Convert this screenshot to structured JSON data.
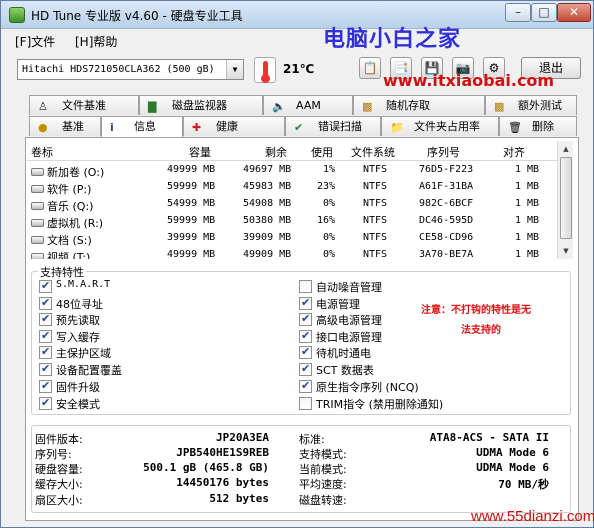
{
  "window": {
    "title": "HD Tune 专业版 v4.60 - 硬盘专业工具"
  },
  "watermarks": {
    "top": "电脑小白之家",
    "url": "www.itxiaobai.com",
    "bottom": "www.55dianzi.com"
  },
  "menu": [
    "[F]文件",
    "[H]帮助"
  ],
  "toolbar": {
    "drive": "Hitachi HDS721050CLA362 (500 gB)",
    "temperature": "21℃",
    "exit_label": "退出"
  },
  "tabs_top": [
    "文件基准",
    "磁盘监视器",
    "AAM",
    "随机存取",
    "额外测试"
  ],
  "tabs_bottom": [
    "基准",
    "信息",
    "健康",
    "错误扫描",
    "文件夹占用率",
    "删除"
  ],
  "partitions": {
    "headers": [
      "卷标",
      "容量",
      "剩余",
      "使用",
      "文件系统",
      "序列号",
      "对齐"
    ],
    "rows": [
      [
        "新加卷 (O:)",
        "49999 MB",
        "49697 MB",
        "1%",
        "NTFS",
        "76D5-F223",
        "1 MB"
      ],
      [
        "软件 (P:)",
        "59999 MB",
        "45983 MB",
        "23%",
        "NTFS",
        "A61F-31BA",
        "1 MB"
      ],
      [
        "音乐 (Q:)",
        "54999 MB",
        "54908 MB",
        "0%",
        "NTFS",
        "982C-6BCF",
        "1 MB"
      ],
      [
        "虚拟机 (R:)",
        "59999 MB",
        "50380 MB",
        "16%",
        "NTFS",
        "DC46-595D",
        "1 MB"
      ],
      [
        "文档 (S:)",
        "39999 MB",
        "39909 MB",
        "0%",
        "NTFS",
        "CE58-CD96",
        "1 MB"
      ],
      [
        "视频 (T:)",
        "49999 MB",
        "49909 MB",
        "0%",
        "NTFS",
        "3A70-BE7A",
        "1 MB"
      ]
    ]
  },
  "features": {
    "title": "支持特性",
    "left": [
      {
        "label": "S.M.A.R.T",
        "checked": true
      },
      {
        "label": "48位寻址",
        "checked": true
      },
      {
        "label": "预先读取",
        "checked": true
      },
      {
        "label": "写入缓存",
        "checked": true
      },
      {
        "label": "主保护区域",
        "checked": true
      },
      {
        "label": "设备配置覆盖",
        "checked": true
      },
      {
        "label": "固件升级",
        "checked": true
      },
      {
        "label": "安全模式",
        "checked": true
      }
    ],
    "right": [
      {
        "label": "自动噪音管理",
        "checked": false
      },
      {
        "label": "电源管理",
        "checked": true
      },
      {
        "label": "高级电源管理",
        "checked": true
      },
      {
        "label": "接口电源管理",
        "checked": true
      },
      {
        "label": "待机时通电",
        "checked": true
      },
      {
        "label": "SCT 数据表",
        "checked": true
      },
      {
        "label": "原生指令序列 (NCQ)",
        "checked": true
      },
      {
        "label": "TRIM指令 (禁用删除通知)",
        "checked": false
      }
    ],
    "note_line1": "注意：不打钩的特性是无",
    "note_line2": "法支持的"
  },
  "info": {
    "left": [
      {
        "label": "固件版本:",
        "value": "JP20A3EA"
      },
      {
        "label": "序列号:",
        "value": "JPB540HE1S9REB"
      },
      {
        "label": "硬盘容量:",
        "value": "500.1 gB (465.8 GB)"
      },
      {
        "label": "缓存大小:",
        "value": "14450176 bytes"
      },
      {
        "label": "扇区大小:",
        "value": "512 bytes"
      }
    ],
    "right": [
      {
        "label": "标准:",
        "value": "ATA8-ACS - SATA II"
      },
      {
        "label": "支持模式:",
        "value": "UDMA Mode 6"
      },
      {
        "label": "当前模式:",
        "value": "UDMA Mode 6"
      },
      {
        "label": "平均速度:",
        "value": "70 MB/秒"
      },
      {
        "label": "磁盘转速:",
        "value": ""
      }
    ]
  }
}
